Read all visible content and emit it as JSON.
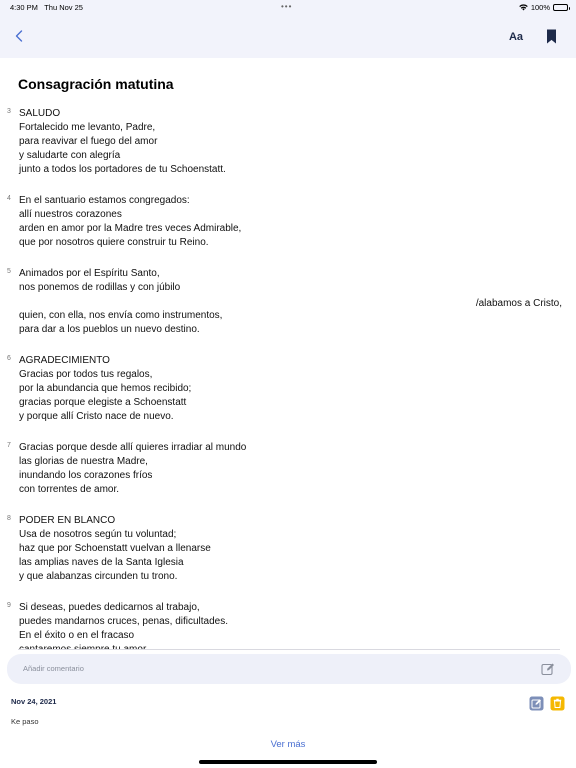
{
  "status_bar": {
    "time": "4:30 PM",
    "date": "Thu Nov 25",
    "dots": "•••",
    "battery": "100%"
  },
  "nav": {
    "back_icon": "chevron-left-icon",
    "font_label": "Aa",
    "bookmark_icon": "bookmark-icon"
  },
  "title": "Consagración matutina",
  "verses": [
    {
      "num": "3",
      "lines": [
        "SALUDO",
        "Fortalecido me levanto, Padre,",
        "para reavivar el fuego del amor",
        "y saludarte con alegría",
        "junto a todos los portadores de tu Schoenstatt."
      ]
    },
    {
      "num": "4",
      "lines": [
        "En el santuario estamos congregados:",
        "allí nuestros corazones",
        "arden en amor por la Madre tres veces Admirable,",
        "que por nosotros quiere construir tu Reino."
      ]
    },
    {
      "num": "5",
      "lines": [
        "Animados por el Espíritu Santo,",
        "nos ponemos de rodillas y con júbilo",
        "/alabamos a Cristo,",
        "quien, con ella, nos envía como instrumentos,",
        "para dar a los pueblos un nuevo destino."
      ]
    },
    {
      "num": "6",
      "lines": [
        "AGRADECIMIENTO",
        "Gracias por todos tus regalos,",
        "por la abundancia que hemos recibido;",
        "gracias porque elegiste a Schoenstatt",
        "y porque allí Cristo nace de nuevo."
      ]
    },
    {
      "num": "7",
      "lines": [
        "Gracias porque desde allí quieres irradiar al mundo",
        "las glorias de nuestra Madre,",
        "inundando los corazones fríos",
        "con torrentes de amor."
      ]
    },
    {
      "num": "8",
      "lines": [
        "PODER EN BLANCO",
        "Usa de nosotros según tu voluntad;",
        "haz que por Schoenstatt vuelvan a llenarse",
        "las amplias naves de la Santa Iglesia",
        "y que alabanzas circunden tu trono."
      ]
    },
    {
      "num": "9",
      "lines": [
        "Si deseas, puedes dedicarnos al trabajo,",
        "puedes mandarnos cruces, penas, dificultades.",
        "En el éxito o en el fracaso",
        "cantaremos siempre tu amor."
      ]
    }
  ],
  "comment": {
    "placeholder": "Añadir comentario",
    "icon": "edit-icon"
  },
  "entry": {
    "date": "Nov 24, 2021",
    "text": "Ke paso",
    "edit_icon": "edit-icon",
    "delete_icon": "trash-icon",
    "delete_color": "#f5b800"
  },
  "see_more": "Ver más",
  "colors": {
    "accent": "#4a6fd1",
    "nav_bg": "#f2f3fb",
    "navy": "#1e2a4a"
  }
}
